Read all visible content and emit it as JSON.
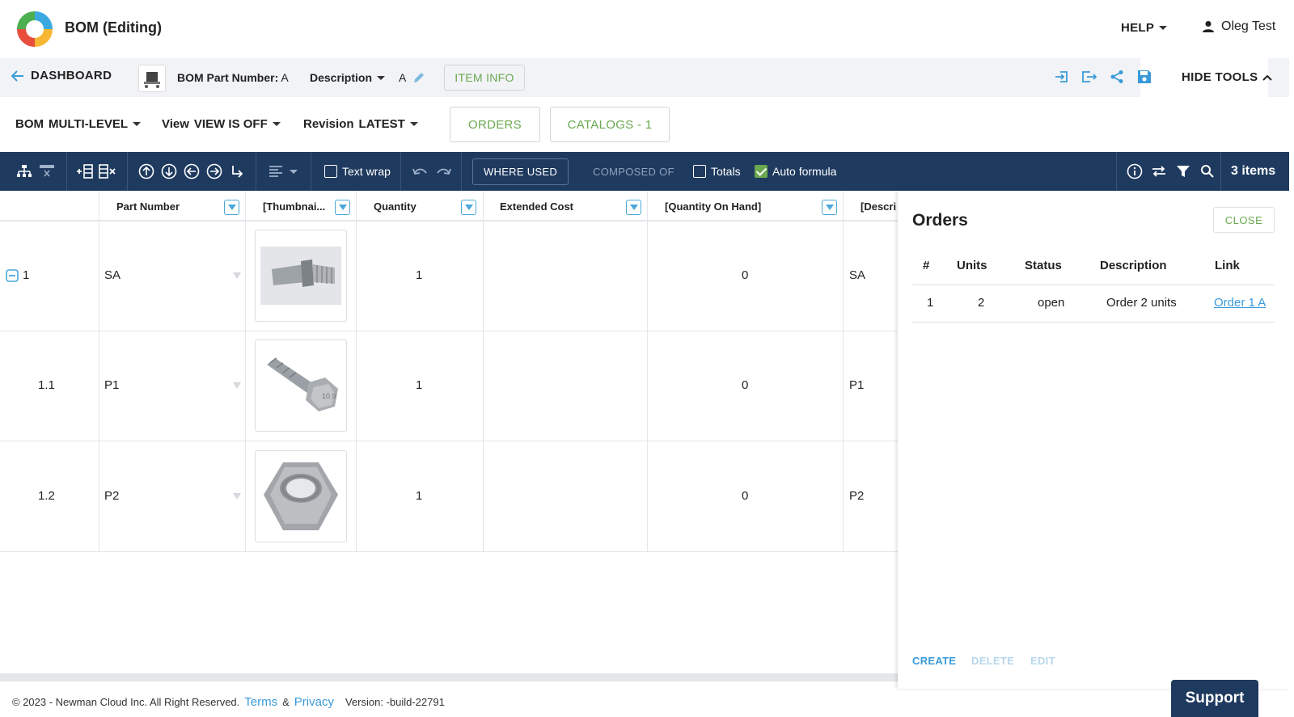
{
  "header": {
    "app_title": "BOM (Editing)",
    "help_label": "HELP",
    "user_name": "Oleg Test"
  },
  "subheader": {
    "dashboard_label": "DASHBOARD",
    "bom_part_label": "BOM Part Number:",
    "bom_part_value": "A",
    "description_label": "Description",
    "description_value": "A",
    "item_info_label": "ITEM INFO",
    "hide_tools_label": "HIDE TOOLS"
  },
  "viewbar": {
    "bom_label": "BOM",
    "bom_value": "MULTI-LEVEL",
    "view_label": "View",
    "view_value": "VIEW IS OFF",
    "revision_label": "Revision",
    "revision_value": "LATEST",
    "orders_label": "ORDERS",
    "catalogs_label": "CATALOGS - 1"
  },
  "toolbar": {
    "text_wrap_label": "Text wrap",
    "where_used_label": "WHERE USED",
    "composed_of_label": "COMPOSED OF",
    "totals_label": "Totals",
    "totals_checked": false,
    "auto_formula_label": "Auto formula",
    "auto_formula_checked": true,
    "items_count": "3 items"
  },
  "table": {
    "columns": [
      "Part Number",
      "[Thumbnai...",
      "Quantity",
      "Extended Cost",
      "[Quantity On Hand]",
      "[Descri"
    ],
    "rows": [
      {
        "level": "1",
        "part_number": "SA",
        "thumbnail": "stud-bolt",
        "quantity": "1",
        "extended_cost": "",
        "qty_on_hand": "0",
        "description": "SA"
      },
      {
        "level": "1.1",
        "part_number": "P1",
        "thumbnail": "hex-bolt",
        "quantity": "1",
        "extended_cost": "",
        "qty_on_hand": "0",
        "description": "P1"
      },
      {
        "level": "1.2",
        "part_number": "P2",
        "thumbnail": "hex-nut",
        "quantity": "1",
        "extended_cost": "",
        "qty_on_hand": "0",
        "description": "P2"
      }
    ]
  },
  "orders_panel": {
    "title": "Orders",
    "close_label": "CLOSE",
    "columns": [
      "#",
      "Units",
      "Status",
      "Description",
      "Link"
    ],
    "rows": [
      {
        "num": "1",
        "units": "2",
        "status": "open",
        "description": "Order 2 units",
        "link": "Order 1 A"
      }
    ],
    "create_label": "CREATE",
    "delete_label": "DELETE",
    "edit_label": "EDIT"
  },
  "footer": {
    "copyright": "© 2023 - Newman Cloud Inc. All Right Reserved.",
    "terms": "Terms",
    "amp": "&",
    "privacy": "Privacy",
    "version": "Version: -build-22791",
    "support_label": "Support"
  },
  "colors": {
    "navy": "#1f3a5f",
    "green": "#6aa84f",
    "link_blue": "#3a9ad9",
    "filter_blue": "#4aa8d8"
  }
}
